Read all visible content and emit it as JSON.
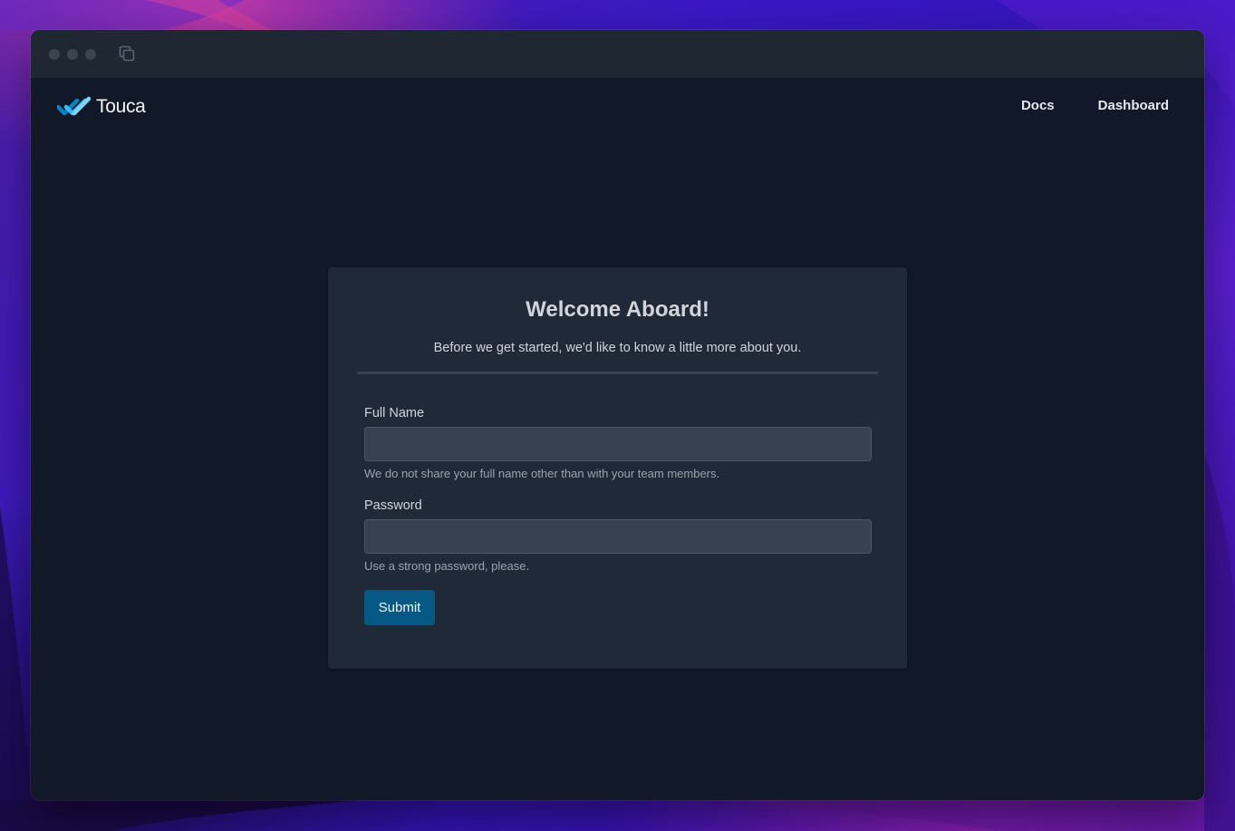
{
  "brand": {
    "name": "Touca",
    "logo_icon": "touca-checkmarks-logo",
    "accent_color": "#38bdf8"
  },
  "titlebar": {
    "icons": [
      "traffic-light-close",
      "traffic-light-minimize",
      "traffic-light-zoom",
      "tabs-overview-icon"
    ]
  },
  "nav": {
    "links": [
      {
        "label": "Docs"
      },
      {
        "label": "Dashboard"
      }
    ]
  },
  "card": {
    "title": "Welcome Aboard!",
    "subtitle": "Before we get started, we'd like to know a little more about you.",
    "fields": {
      "full_name": {
        "label": "Full Name",
        "value": "",
        "placeholder": "",
        "help": "We do not share your full name other than with your team members."
      },
      "password": {
        "label": "Password",
        "value": "",
        "placeholder": "",
        "help": "Use a strong password, please."
      }
    },
    "submit_label": "Submit",
    "submit_color": "#075985"
  }
}
